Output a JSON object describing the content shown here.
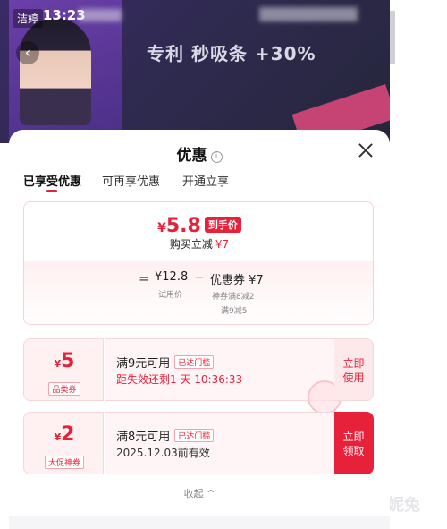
{
  "status_bar": {
    "time": "13:23",
    "brand_tag": "洁婷"
  },
  "backdrop": {
    "banner_text": "专利 秒吸条 +30%"
  },
  "watermark": "可妮兔",
  "sheet": {
    "title": "优惠",
    "info_icon": "i",
    "tabs": [
      "已享受优惠",
      "可再享优惠",
      "开通立享"
    ],
    "summary": {
      "currency": "¥",
      "final_price": "5.8",
      "final_price_tag": "到手价",
      "discount_label": "购买立减",
      "discount_amount": "¥7",
      "equals": "=",
      "trial_price": "¥12.8",
      "trial_price_caption": "试用价",
      "minus": "−",
      "coupon_total": "优惠券 ¥7",
      "coupon_detail_1": "神券满8减2",
      "coupon_detail_2": "满9减5"
    },
    "coupons": [
      {
        "currency": "¥",
        "amount": "5",
        "type": "品类券",
        "condition": "满9元可用",
        "badge": "已达门槛",
        "subtext": "距失效还剩1 天 10:36:33",
        "action_line1": "立即",
        "action_line2": "使用"
      },
      {
        "currency": "¥",
        "amount": "2",
        "type": "大促神券",
        "condition": "满8元可用",
        "badge": "已达门槛",
        "subtext": "2025.12.03前有效",
        "action_line1": "立即",
        "action_line2": "领取"
      }
    ],
    "collapse_label": "收起 ^"
  },
  "colors": {
    "accent": "#e8213a",
    "coupon_bg": "#fff5f6",
    "backdrop": "#2e2a4f"
  }
}
